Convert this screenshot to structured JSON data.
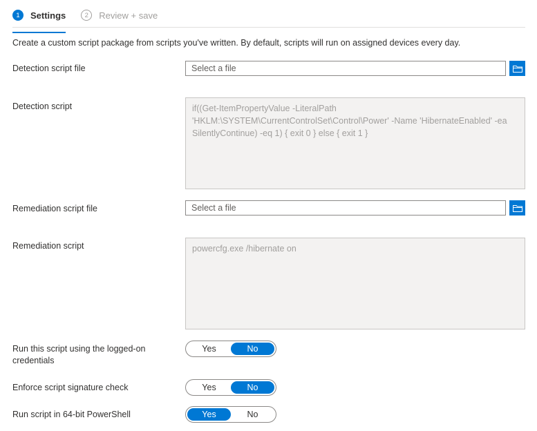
{
  "tabs": [
    {
      "step": "1",
      "label": "Settings",
      "active": true
    },
    {
      "step": "2",
      "label": "Review + save",
      "active": false
    }
  ],
  "description": "Create a custom script package from scripts you've written. By default, scripts will run on assigned devices every day.",
  "detection_file": {
    "label": "Detection script file",
    "placeholder": "Select a file",
    "browse_icon": "folder-icon"
  },
  "detection_script": {
    "label": "Detection script",
    "content": "if((Get-ItemPropertyValue -LiteralPath\n'HKLM:\\SYSTEM\\CurrentControlSet\\Control\\Power' -Name 'HibernateEnabled' -ea\nSilentlyContinue) -eq 1) { exit 0 } else { exit 1 }"
  },
  "remediation_file": {
    "label": "Remediation script file",
    "placeholder": "Select a file",
    "browse_icon": "folder-icon"
  },
  "remediation_script": {
    "label": "Remediation script",
    "content": "powercfg.exe /hibernate on"
  },
  "toggles": [
    {
      "label": "Run this script using the logged-on credentials",
      "yes": "Yes",
      "no": "No",
      "selected": "No"
    },
    {
      "label": "Enforce script signature check",
      "yes": "Yes",
      "no": "No",
      "selected": "No"
    },
    {
      "label": "Run script in 64-bit PowerShell",
      "yes": "Yes",
      "no": "No",
      "selected": "Yes"
    }
  ],
  "colors": {
    "accent": "#0078d4",
    "text": "#323130",
    "muted": "#a19f9d",
    "disabled_bg": "#f3f2f1"
  }
}
